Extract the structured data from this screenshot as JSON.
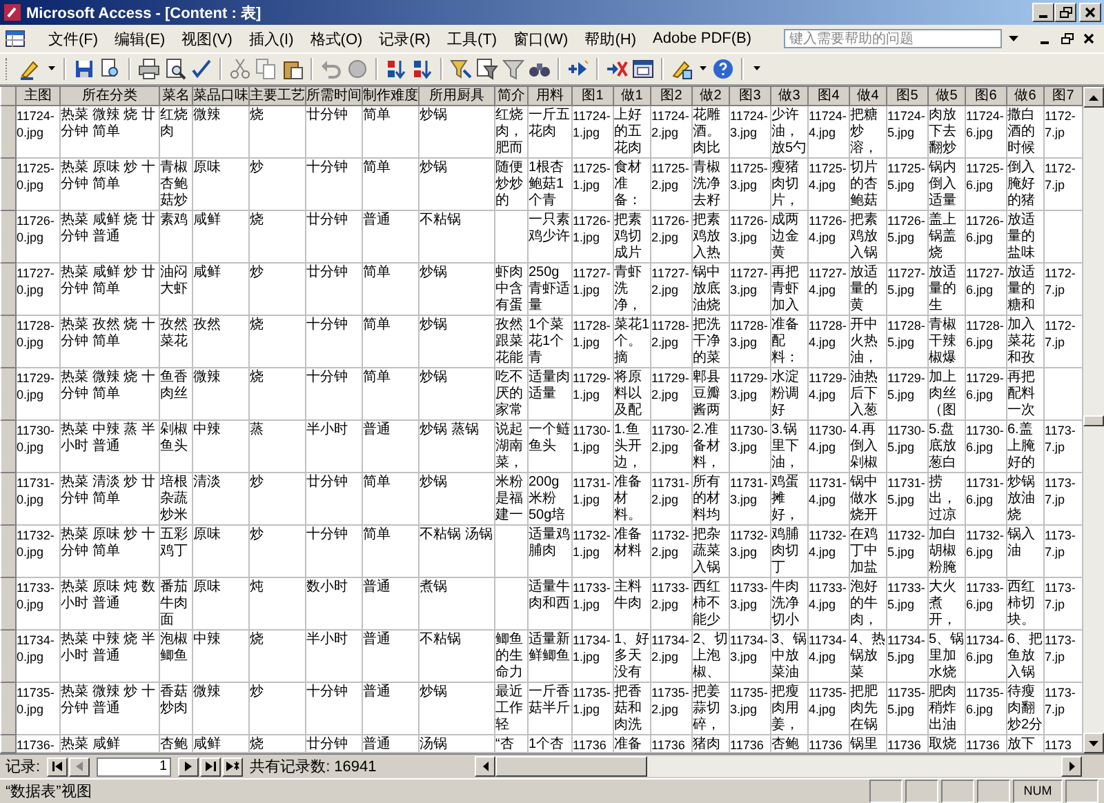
{
  "window": {
    "title": "Microsoft Access - [Content : 表]"
  },
  "menu": [
    "文件(F)",
    "编辑(E)",
    "视图(V)",
    "插入(I)",
    "格式(O)",
    "记录(R)",
    "工具(T)",
    "窗口(W)",
    "帮助(H)",
    "Adobe PDF(B)"
  ],
  "help_box": {
    "placeholder": "键入需要帮助的问题"
  },
  "table": {
    "columns": [
      "主图",
      "所在分类",
      "菜名",
      "菜品口味",
      "主要工艺",
      "所需时间",
      "制作难度",
      "所用厨具",
      "简介",
      "用料",
      "图1",
      "做1",
      "图2",
      "做2",
      "图3",
      "做3",
      "图4",
      "做4",
      "图5",
      "做5",
      "图6",
      "做6",
      "图7"
    ],
    "rows": [
      [
        "11724-0.jpg",
        "热菜 微辣 烧 廿分钟 简单",
        "红烧肉",
        "微辣",
        "烧",
        "廿分钟",
        "简单",
        "炒锅",
        "红烧肉，肥而",
        "一斤五花肉",
        "11724-1.jpg",
        "上好的五花肉",
        "11724-2.jpg",
        "花雕酒。肉比",
        "11724-3.jpg",
        "少许油，放5勺",
        "11724-4.jpg",
        "把糖炒溶，",
        "11724-5.jpg",
        "肉放下去翻炒",
        "11724-6.jpg",
        "撒白酒的时候",
        "1172-7.jp"
      ],
      [
        "11725-0.jpg",
        "热菜 原味 炒 十分钟 简单",
        "青椒杏鲍菇炒",
        "原味",
        "炒",
        "十分钟",
        "简单",
        "炒锅",
        "随便炒炒的",
        "1根杏鲍菇1个青",
        "11725-1.jpg",
        "食材准备：",
        "11725-2.jpg",
        "青椒洗净去籽",
        "11725-3.jpg",
        "瘦猪肉切片，",
        "11725-4.jpg",
        "切片的杏鲍菇",
        "11725-5.jpg",
        "锅内倒入适量",
        "11725-6.jpg",
        "倒入腌好的猪",
        "1172-7.jp"
      ],
      [
        "11726-0.jpg",
        "热菜 咸鲜 烧 廿分钟 普通",
        "素鸡",
        "咸鲜",
        "烧",
        "廿分钟",
        "普通",
        "不粘锅",
        null,
        "一只素鸡少许",
        "11726-1.jpg",
        "把素鸡切成片",
        "11726-2.jpg",
        "把素鸡放入热",
        "11726-3.jpg",
        "成两边金黄",
        "11726-4.jpg",
        "把素鸡放入锅",
        "11726-5.jpg",
        "盖上锅盖烧",
        "11726-6.jpg",
        "放适量的盐味",
        null
      ],
      [
        "11727-0.jpg",
        "热菜 咸鲜 炒 廿分钟 简单",
        "油闷大虾",
        "咸鲜",
        "炒",
        "廿分钟",
        "简单",
        "炒锅",
        "虾肉中含有蛋",
        "250g青虾适量",
        "11727-1.jpg",
        "青虾洗净，",
        "11727-2.jpg",
        "锅中放底油烧",
        "11727-3.jpg",
        "再把青虾加入",
        "11727-4.jpg",
        "放适量的黄",
        "11727-5.jpg",
        "放适量的生",
        "11727-6.jpg",
        "放适量的糖和",
        "1172-7.jp"
      ],
      [
        "11728-0.jpg",
        "热菜 孜然 烧 十分钟 简单",
        "孜然菜花",
        "孜然",
        "烧",
        "十分钟",
        "简单",
        "炒锅",
        "孜然跟菜花能",
        "1个菜花1个青",
        "11728-1.jpg",
        "菜花1个。摘",
        "11728-2.jpg",
        "把洗干净的菜",
        "11728-3.jpg",
        "准备配料：",
        "11728-4.jpg",
        "开中火热油，",
        "11728-5.jpg",
        "青椒干辣椒爆",
        "11728-6.jpg",
        "加入菜花和孜",
        "1172-7.jp"
      ],
      [
        "11729-0.jpg",
        "热菜 微辣 烧 十分钟 简单",
        "鱼香肉丝",
        "微辣",
        "烧",
        "十分钟",
        "简单",
        "炒锅",
        "吃不厌的家常",
        "适量肉适量",
        "11729-1.jpg",
        "将原料以及配",
        "11729-2.jpg",
        "郫县豆瓣酱两",
        "11729-3.jpg",
        "水淀粉调好",
        "11729-4.jpg",
        "油热后下入葱",
        "11729-5.jpg",
        "加上肉丝（图",
        "11729-6.jpg",
        "再把配料一次",
        null
      ],
      [
        "11730-0.jpg",
        "热菜 中辣 蒸 半小时 普通",
        "剁椒鱼头",
        "中辣",
        "蒸",
        "半小时",
        "普通",
        "炒锅 蒸锅",
        "说起湖南菜，",
        "一个鲢鱼头",
        "11730-1.jpg",
        "1.鱼头开边，",
        "11730-2.jpg",
        "2.准备材料，",
        "11730-3.jpg",
        "3.锅里下油，",
        "11730-4.jpg",
        "4.再倒入剁椒",
        "11730-5.jpg",
        "5.盘底放葱白",
        "11730-6.jpg",
        "6.盖上腌好的",
        "1173-7.jp"
      ],
      [
        "11731-0.jpg",
        "热菜 清淡 炒 廿分钟 简单",
        "培根杂蔬炒米",
        "清淡",
        "炒",
        "廿分钟",
        "简单",
        "炒锅",
        "米粉是福建一",
        "200g米粉50g培",
        "11731-1.jpg",
        "准备材料。",
        "11731-2.jpg",
        "所有的材料均",
        "11731-3.jpg",
        "鸡蛋摊好，",
        "11731-4.jpg",
        "锅中做水烧开",
        "11731-5.jpg",
        "捞出，过凉",
        "11731-6.jpg",
        "炒锅放油烧",
        "1173-7.jp"
      ],
      [
        "11732-0.jpg",
        "热菜 原味 炒 十分钟 简单",
        "五彩鸡丁",
        "原味",
        "炒",
        "十分钟",
        "简单",
        "不粘锅 汤锅",
        null,
        "适量鸡脯肉",
        "11732-1.jpg",
        "准备材料",
        "11732-2.jpg",
        "把杂蔬菜入锅",
        "11732-3.jpg",
        "鸡脯肉切丁",
        "11732-4.jpg",
        "在鸡丁中加盐",
        "11732-5.jpg",
        "加白胡椒粉腌",
        "11732-6.jpg",
        "锅入油",
        "1173-7.jp"
      ],
      [
        "11733-0.jpg",
        "热菜 原味 炖 数小时 普通",
        "番茄牛肉面",
        "原味",
        "炖",
        "数小时",
        "普通",
        "煮锅",
        null,
        "适量牛肉和西",
        "11733-1.jpg",
        "主料牛肉",
        "11733-2.jpg",
        "西红柿不能少",
        "11733-3.jpg",
        "牛肉洗净切小",
        "11733-4.jpg",
        "泡好的牛肉，",
        "11733-5.jpg",
        "大火煮开，",
        "11733-6.jpg",
        "西红柿切块。",
        "1173-7.jp"
      ],
      [
        "11734-0.jpg",
        "热菜 中辣 烧 半小时 普通",
        "泡椒鲫鱼",
        "中辣",
        "烧",
        "半小时",
        "普通",
        "不粘锅",
        "鲫鱼的生命力",
        "适量新鲜鲫鱼",
        "11734-1.jpg",
        "1、好多天没有",
        "11734-2.jpg",
        "2、切上泡椒、",
        "11734-3.jpg",
        "3、锅中放菜油",
        "11734-4.jpg",
        "4、热锅放菜",
        "11734-5.jpg",
        "5、锅里加水烧",
        "11734-6.jpg",
        "6、把鱼放入锅",
        "1173-7.jp"
      ],
      [
        "11735-0.jpg",
        "热菜 微辣 炒 十分钟 普通",
        "香菇炒肉",
        "微辣",
        "炒",
        "十分钟",
        "普通",
        "炒锅",
        "最近工作轻",
        "一斤香菇半斤",
        "11735-1.jpg",
        "把香菇和肉洗",
        "11735-2.jpg",
        "把姜蒜切碎，",
        "11735-3.jpg",
        "把瘦肉用姜，",
        "11735-4.jpg",
        "把肥肉先在锅",
        "11735-5.jpg",
        "肥肉稍炸出油",
        "11735-6.jpg",
        "待瘦肉翻炒2分",
        "1173-7.jp"
      ]
    ],
    "partial_row": [
      "11736-",
      "热菜 咸鲜",
      "杏鲍",
      "咸鲜",
      "烧",
      "廿分钟",
      "普通",
      "汤锅",
      "“杏",
      "1个杏",
      "11736",
      "准备",
      "11736",
      "猪肉",
      "11736",
      "杏鲍",
      "11736",
      "锅里",
      "11736",
      "取烧",
      "11736",
      "放下",
      "1173"
    ]
  },
  "record_nav": {
    "label": "记录:",
    "current": "1",
    "total": "共有记录数: 16941"
  },
  "status_bar": {
    "view": "“数据表”视图",
    "indicator": "NUM"
  }
}
